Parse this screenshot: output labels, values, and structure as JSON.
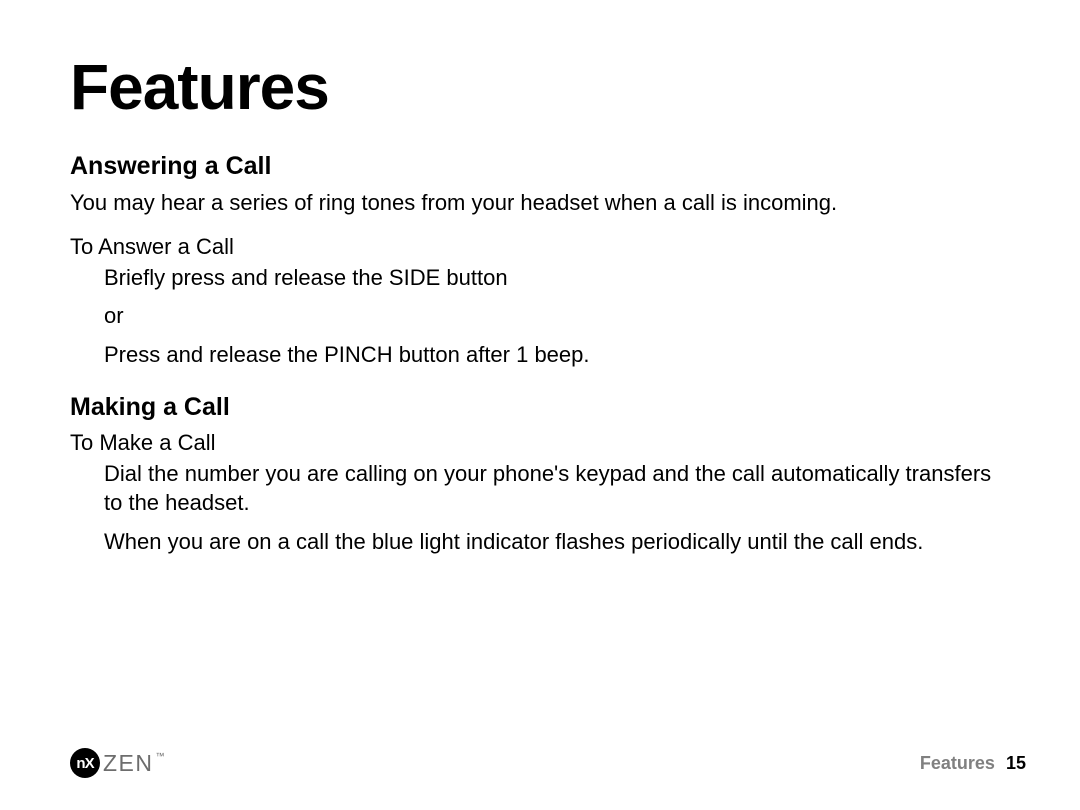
{
  "title": "Features",
  "section1": {
    "heading": "Answering a Call",
    "intro": "You may hear a series of ring tones from your headset when a call is incoming.",
    "subtitle": "To Answer a Call",
    "steps": [
      "Briefly press and release the SIDE button",
      "or",
      "Press and release the PINCH button after 1 beep."
    ]
  },
  "section2": {
    "heading": "Making a Call",
    "subtitle": "To Make a Call",
    "steps": [
      "Dial the number you are calling on your phone's keypad and the call automatically transfers to the headset.",
      "When you are on a call the blue light indicator flashes periodically until the call ends."
    ]
  },
  "footer": {
    "logo_inner": "nX",
    "logo_text": "ZEN",
    "logo_tm": "™",
    "page_label": "Features",
    "page_number": "15"
  }
}
